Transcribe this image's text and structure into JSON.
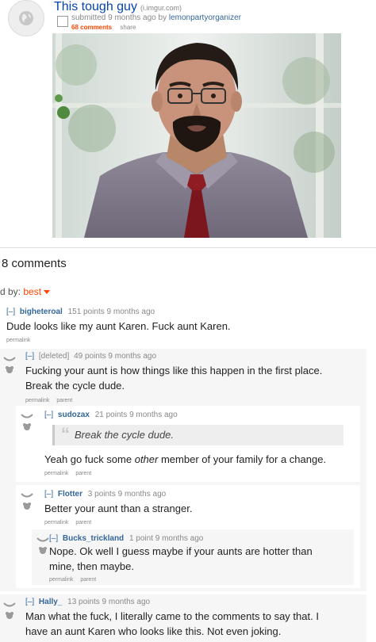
{
  "post": {
    "title": "This tough guy",
    "domain": "(i.imgur.com)",
    "tagline_prefix": "submitted 9 months ago by",
    "author": "lemonpartyorganizer",
    "comments_link": "68 comments",
    "share_link": "share"
  },
  "comments_header": "8 comments",
  "sort": {
    "label": "d by:",
    "value": "best"
  },
  "colors": {
    "link": "#336699",
    "title": "#0645ad",
    "accent": "#ff4500",
    "meta": "#888888"
  },
  "comments": [
    {
      "toggle": "[–]",
      "author": "bigheteroal",
      "meta": "151 points 9 months ago",
      "text": "Dude looks like my aunt Karen. Fuck aunt Karen.",
      "links": [
        "permalink"
      ]
    },
    {
      "toggle": "[–]",
      "author": "[deleted]",
      "meta": "49 points 9 months ago",
      "text_lines": [
        "Fucking your aunt is how things like this happen in the first place.",
        "Break the cycle dude."
      ],
      "links": [
        "permalink",
        "parent"
      ]
    },
    {
      "toggle": "[–]",
      "author": "sudozax",
      "meta": "21 points 9 months ago",
      "quote": "Break the cycle dude.",
      "text_before": "Yeah go fuck some ",
      "text_em": "other",
      "text_after": " member of your family for a change.",
      "links": [
        "permalink",
        "parent"
      ]
    },
    {
      "toggle": "[–]",
      "author": "Flotter",
      "meta": "3 points 9 months ago",
      "text": "Better your aunt than a stranger.",
      "links": [
        "permalink",
        "parent"
      ]
    },
    {
      "toggle": "[–]",
      "author": "Bucks_trickland",
      "meta": "1 point 9 months ago",
      "text_lines": [
        "Nope. Ok well I guess maybe if your aunts are hotter than",
        "mine, then maybe."
      ],
      "links": [
        "permalink",
        "parent"
      ]
    },
    {
      "toggle": "[–]",
      "author": "Hally_",
      "meta": "13 points 9 months ago",
      "text_lines": [
        "Man what the fuck, I literally came to the comments to say that. I",
        "have an aunt Karen who looks like this. Not even joking."
      ]
    }
  ]
}
